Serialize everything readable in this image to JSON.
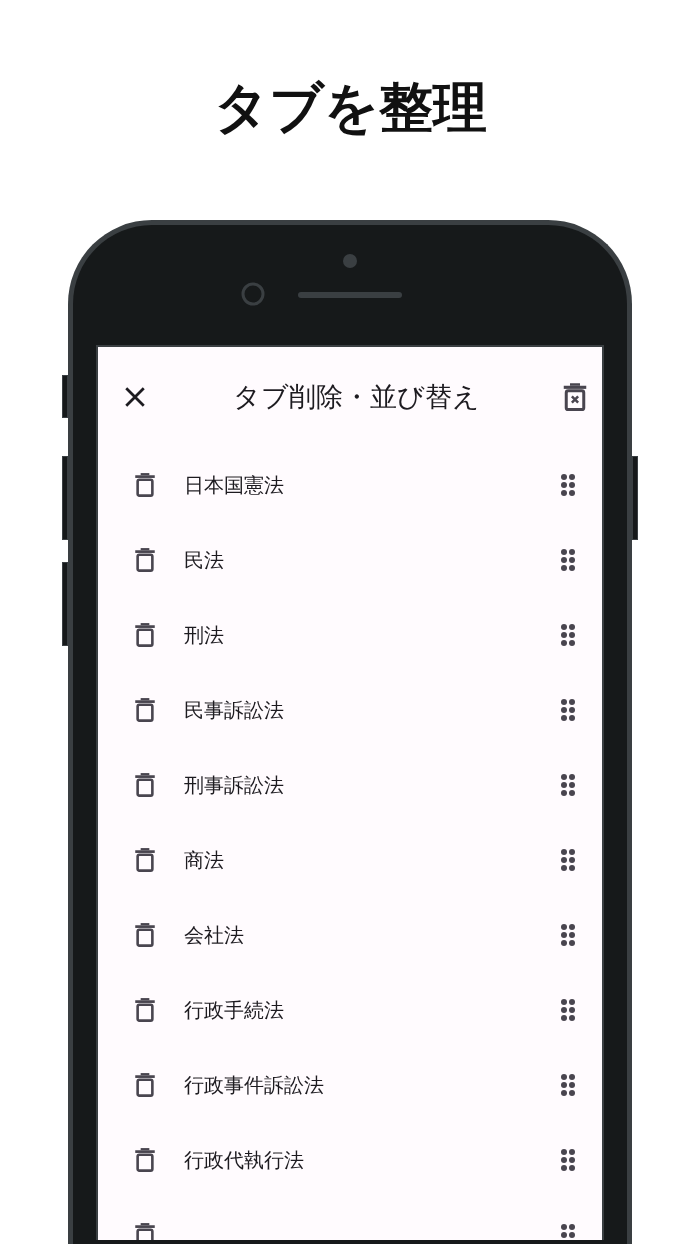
{
  "headline": "タブを整理",
  "app_bar": {
    "title": "タブ削除・並び替え"
  },
  "tabs": [
    {
      "name": "日本国憲法"
    },
    {
      "name": "民法"
    },
    {
      "name": "刑法"
    },
    {
      "name": "民事訴訟法"
    },
    {
      "name": "刑事訴訟法"
    },
    {
      "name": "商法"
    },
    {
      "name": "会社法"
    },
    {
      "name": "行政手続法"
    },
    {
      "name": "行政事件訴訟法"
    },
    {
      "name": "行政代執行法"
    }
  ],
  "more_below": true
}
